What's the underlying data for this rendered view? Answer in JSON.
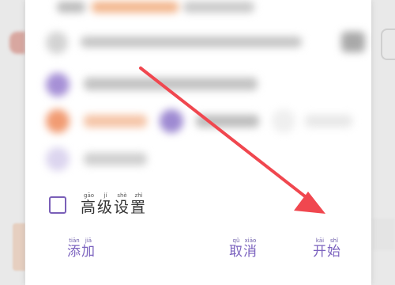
{
  "dialog": {
    "advanced_settings": {
      "label_chars": [
        {
          "char": "高",
          "pinyin": "gāo"
        },
        {
          "char": "级",
          "pinyin": "jí"
        },
        {
          "char": "设",
          "pinyin": "shè"
        },
        {
          "char": "置",
          "pinyin": "zhì"
        }
      ]
    },
    "actions": {
      "add": [
        {
          "char": "添",
          "pinyin": "tiān"
        },
        {
          "char": "加",
          "pinyin": "jiā"
        }
      ],
      "cancel": [
        {
          "char": "取",
          "pinyin": "qǔ"
        },
        {
          "char": "消",
          "pinyin": "xiāo"
        }
      ],
      "start": [
        {
          "char": "开",
          "pinyin": "kāi"
        },
        {
          "char": "始",
          "pinyin": "shǐ"
        }
      ]
    }
  },
  "colors": {
    "accent": "#7c63bf",
    "annotation_arrow": "#f0474f"
  }
}
